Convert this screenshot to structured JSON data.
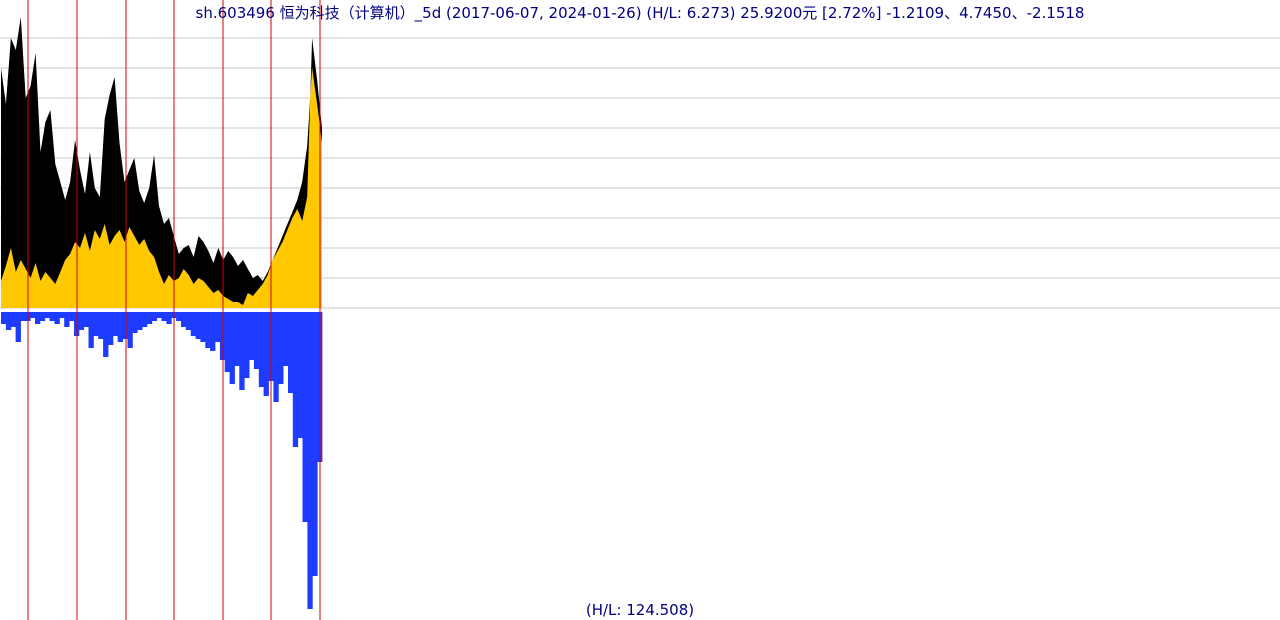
{
  "title_text": "sh.603496 恒为科技（计算机）_5d (2017-06-07, 2024-01-26) (H/L: 6.273) 25.9200元 [2.72%]  -1.2109、4.7450、-2.1518",
  "footer_text": "(H/L: 124.508)",
  "colors": {
    "price_dark": "#000000",
    "price_fill": "#ffc800",
    "volume": "#1e3cff",
    "vline": "#d40000",
    "gridline": "#c8c8c8",
    "background": "#ffffff"
  },
  "chart_data": {
    "type": "area",
    "grid": true,
    "range_start": "2017-06-07",
    "range_end": "2024-01-26",
    "last_price": 25.92,
    "last_change_pct": 2.72,
    "price_high_low_ratio": 6.273,
    "volume_high_low_ratio": 124.508,
    "indicators": [
      -1.2109,
      4.745,
      -2.1518
    ],
    "series": [
      {
        "role": "price_upper",
        "values": [
          0.8,
          0.68,
          0.9,
          0.86,
          0.97,
          0.7,
          0.74,
          0.85,
          0.52,
          0.62,
          0.66,
          0.48,
          0.42,
          0.36,
          0.42,
          0.56,
          0.46,
          0.38,
          0.52,
          0.4,
          0.37,
          0.63,
          0.71,
          0.77,
          0.55,
          0.42,
          0.46,
          0.5,
          0.39,
          0.35,
          0.4,
          0.51,
          0.34,
          0.28,
          0.3,
          0.24,
          0.18,
          0.2,
          0.21,
          0.17,
          0.24,
          0.22,
          0.19,
          0.15,
          0.2,
          0.16,
          0.19,
          0.17,
          0.14,
          0.16,
          0.13,
          0.1,
          0.11,
          0.09,
          0.12,
          0.16,
          0.19,
          0.22,
          0.26,
          0.3,
          0.33,
          0.29,
          0.37,
          0.9,
          0.76,
          0.6
        ]
      },
      {
        "role": "price_lower",
        "values": [
          0.09,
          0.14,
          0.2,
          0.12,
          0.16,
          0.13,
          0.1,
          0.15,
          0.09,
          0.12,
          0.1,
          0.08,
          0.12,
          0.16,
          0.18,
          0.22,
          0.2,
          0.25,
          0.19,
          0.26,
          0.23,
          0.28,
          0.21,
          0.24,
          0.26,
          0.22,
          0.27,
          0.24,
          0.21,
          0.23,
          0.19,
          0.17,
          0.12,
          0.08,
          0.11,
          0.09,
          0.1,
          0.13,
          0.11,
          0.08,
          0.1,
          0.09,
          0.07,
          0.05,
          0.06,
          0.04,
          0.03,
          0.02,
          0.02,
          0.01,
          0.05,
          0.04,
          0.06,
          0.08,
          0.11,
          0.16,
          0.2,
          0.24,
          0.28,
          0.32,
          0.36,
          0.42,
          0.54,
          0.8,
          0.68,
          0.55
        ]
      },
      {
        "role": "volume",
        "values": [
          0.04,
          0.06,
          0.05,
          0.1,
          0.03,
          0.03,
          0.02,
          0.04,
          0.03,
          0.02,
          0.03,
          0.04,
          0.02,
          0.05,
          0.03,
          0.08,
          0.06,
          0.05,
          0.12,
          0.08,
          0.09,
          0.15,
          0.11,
          0.08,
          0.1,
          0.09,
          0.12,
          0.07,
          0.06,
          0.05,
          0.04,
          0.03,
          0.02,
          0.03,
          0.04,
          0.02,
          0.03,
          0.05,
          0.06,
          0.08,
          0.09,
          0.1,
          0.12,
          0.13,
          0.1,
          0.16,
          0.2,
          0.24,
          0.18,
          0.26,
          0.22,
          0.16,
          0.19,
          0.25,
          0.28,
          0.23,
          0.3,
          0.24,
          0.18,
          0.27,
          0.45,
          0.42,
          0.7,
          0.99,
          0.88,
          0.5
        ]
      }
    ],
    "markers": [
      28,
      77,
      126,
      174,
      223,
      271,
      320
    ]
  }
}
